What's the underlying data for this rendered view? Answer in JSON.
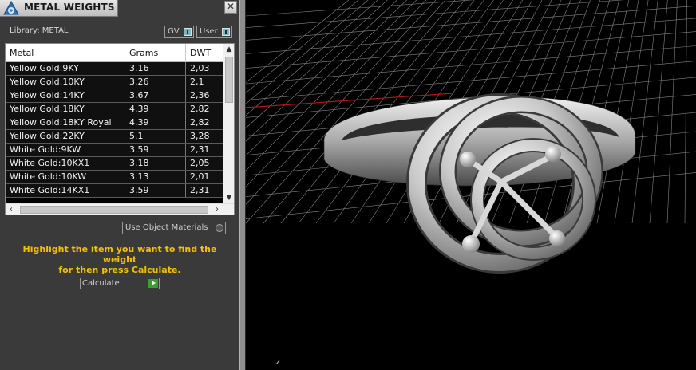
{
  "window": {
    "title": "METAL WEIGHTS",
    "close_glyph": "✕"
  },
  "library": {
    "label": "Library: METAL",
    "gv_label": "GV",
    "user_label": "User"
  },
  "table": {
    "columns": [
      "Metal",
      "Grams",
      "DWT"
    ],
    "rows": [
      {
        "metal": "Yellow Gold:9KY",
        "grams": "3.16",
        "dwt": "2,03"
      },
      {
        "metal": "Yellow Gold:10KY",
        "grams": "3.26",
        "dwt": "2,1"
      },
      {
        "metal": "Yellow Gold:14KY",
        "grams": "3.67",
        "dwt": "2,36"
      },
      {
        "metal": "Yellow Gold:18KY",
        "grams": "4.39",
        "dwt": "2,82"
      },
      {
        "metal": "Yellow Gold:18KY Royal",
        "grams": "4.39",
        "dwt": "2,82"
      },
      {
        "metal": "Yellow Gold:22KY",
        "grams": "5.1",
        "dwt": "3,28"
      },
      {
        "metal": "White Gold:9KW",
        "grams": "3.59",
        "dwt": "2,31"
      },
      {
        "metal": "White Gold:10KX1",
        "grams": "3.18",
        "dwt": "2,05"
      },
      {
        "metal": "White Gold:10KW",
        "grams": "3.13",
        "dwt": "2,01"
      },
      {
        "metal": "White Gold:14KX1",
        "grams": "3.59",
        "dwt": "2,31"
      }
    ]
  },
  "use_object_materials_label": "Use Object Materials",
  "hint_line1": "Highlight the item you want to find the weight",
  "hint_line2": "for then press Calculate.",
  "calculate_label": "Calculate",
  "viewport": {
    "axis_label": "z",
    "grid_color": "#b4b4b4",
    "x_axis_color": "#b01818",
    "background": "#000000"
  }
}
